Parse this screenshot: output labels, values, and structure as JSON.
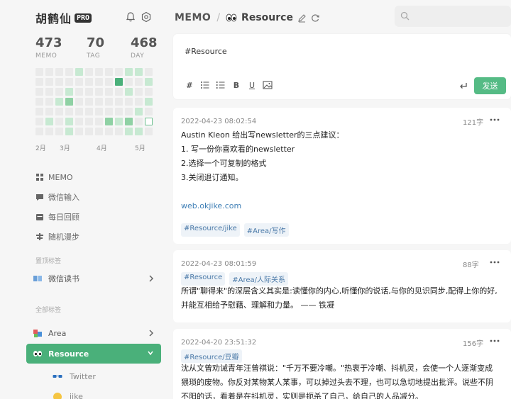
{
  "user": {
    "name": "胡鹤仙",
    "badge": "PRO"
  },
  "stats": [
    {
      "value": "473",
      "label": "MEMO"
    },
    {
      "value": "70",
      "label": "TAG"
    },
    {
      "value": "468",
      "label": "DAY"
    }
  ],
  "heatmap": {
    "levels": [
      [
        0,
        0,
        0,
        0,
        1,
        0,
        0,
        0,
        0,
        1,
        1,
        0
      ],
      [
        0,
        0,
        0,
        0,
        0,
        0,
        0,
        0,
        3,
        0,
        0,
        1
      ],
      [
        0,
        0,
        0,
        1,
        0,
        0,
        0,
        0,
        0,
        1,
        0,
        0
      ],
      [
        0,
        0,
        1,
        2,
        0,
        0,
        0,
        0,
        0,
        0,
        0,
        1
      ],
      [
        0,
        0,
        0,
        0,
        0,
        0,
        0,
        0,
        0,
        0,
        1,
        0
      ],
      [
        0,
        1,
        0,
        1,
        0,
        0,
        0,
        2,
        1,
        2,
        0,
        4
      ],
      [
        0,
        0,
        0,
        1,
        0,
        0,
        0,
        0,
        0,
        1,
        1,
        0
      ]
    ]
  },
  "months": [
    "2月",
    "3月",
    "4月",
    "5月"
  ],
  "nav": [
    {
      "label": "MEMO",
      "icon": "grid-icon"
    },
    {
      "label": "微信输入",
      "icon": "chat-icon"
    },
    {
      "label": "每日回顾",
      "icon": "calendar-icon"
    },
    {
      "label": "随机漫步",
      "icon": "shuffle-icon"
    }
  ],
  "pinned_title": "置顶标签",
  "pinned": [
    {
      "label": "微信读书",
      "icon": "book-icon"
    }
  ],
  "all_tags_title": "全部标签",
  "tags": [
    {
      "label": "Area",
      "icon": "blocks-icon"
    },
    {
      "label": "Resource",
      "icon": "eyes-icon"
    }
  ],
  "subtags": [
    {
      "label": "Twitter",
      "icon": "glasses-icon"
    },
    {
      "label": "jike",
      "icon": "face-icon"
    }
  ],
  "header": {
    "root": "MEMO",
    "sep": "/",
    "tag": "Resource"
  },
  "search": {
    "placeholder": ""
  },
  "editor": {
    "content": "#Resource",
    "tools": [
      "#",
      "•",
      "1.",
      "B",
      "U",
      "img"
    ],
    "send": "发送"
  },
  "memos": [
    {
      "time": "2022-04-23 08:02:54",
      "count": "121字",
      "lines": [
        "Austin Kleon 给出写newsletter的三点建议：",
        "1. 写一份你喜欢看的newsletter",
        "2.选择一个可复制的格式",
        "3.关闭退订通知。",
        "",
        "web.okjike.com"
      ],
      "tags": [
        "#Resource/jike",
        "#Area/写作"
      ]
    },
    {
      "time": "2022-04-23 08:01:59",
      "count": "88字",
      "tags": [
        "#Resource",
        "#Area/人际关系"
      ],
      "lines": [
        "所谓\"聊得来\"的深层含义其实是:读懂你的内心,听懂你的说话,与你的见识同步,配得上你的好,",
        "并能互相给予慰藉、理解和力量。 —— 铁凝"
      ]
    },
    {
      "time": "2022-04-20 23:51:32",
      "count": "156字",
      "tags": [
        "#Resource/豆瓣"
      ],
      "lines": [
        "沈从文曾劝诫青年汪曾祺说：\"千万不要冷嘲。\"热衷于冷嘲、抖机灵，会使一个人逐渐变成",
        "猥琐的废物。你反对某物某人某事，可以掉过头去不理，也可以急切地提出批评。说些不阴",
        "不阳的话，看着是在抖机灵，实则是扼杀了自己，给自己的人品减分。"
      ]
    }
  ],
  "colors": {
    "accent": "#4ab07a",
    "send": "#55bb85",
    "link": "#3f7fb6",
    "chip_bg": "#eef3f8",
    "chip_fg": "#4b7aa8"
  }
}
